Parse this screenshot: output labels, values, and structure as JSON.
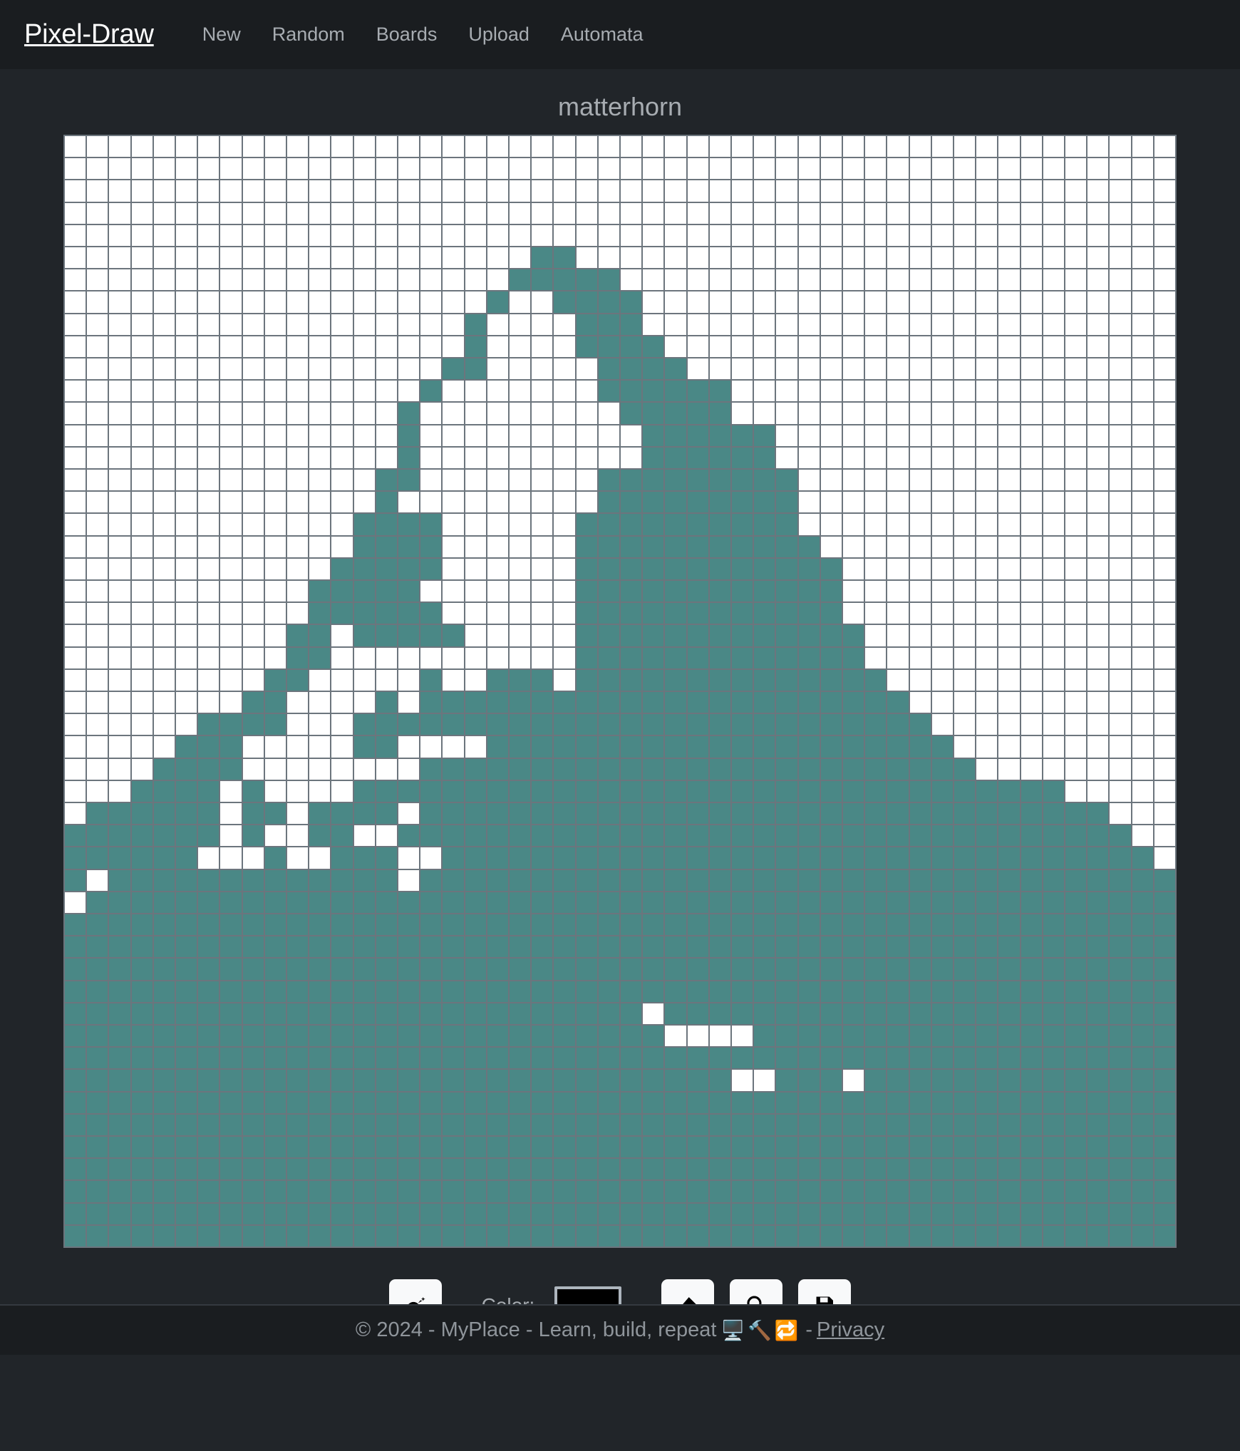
{
  "navbar": {
    "brand": "Pixel-Draw",
    "links": [
      {
        "label": "New",
        "name": "nav-link-new"
      },
      {
        "label": "Random",
        "name": "nav-link-random"
      },
      {
        "label": "Boards",
        "name": "nav-link-boards"
      },
      {
        "label": "Upload",
        "name": "nav-link-upload"
      },
      {
        "label": "Automata",
        "name": "nav-link-automata"
      }
    ]
  },
  "board": {
    "title": "matterhorn",
    "rows": 50,
    "cols": 50,
    "on_color": "#4a8886",
    "off_color": "#ffffff",
    "grid_line_color": "#6c757d"
  },
  "toolbar": {
    "bomb_icon": "bomb-icon",
    "color_label": "Color:",
    "color_value": "#000000",
    "eraser_icon": "eraser-icon",
    "zoom_icon": "magnifier-icon",
    "save_icon": "floppy-disk-icon"
  },
  "footer": {
    "copyright": "© 2024 - MyPlace - Learn, build, repeat",
    "emojis": "🖥️🔨🔁",
    "separator": "-",
    "privacy_label": "Privacy"
  },
  "pixels": {
    "5": [
      [
        21,
        22
      ]
    ],
    "6": [
      [
        20,
        24
      ]
    ],
    "7": [
      [
        19,
        19
      ],
      [
        22,
        25
      ]
    ],
    "8": [
      [
        18,
        18
      ],
      [
        23,
        25
      ]
    ],
    "9": [
      [
        18,
        18
      ],
      [
        23,
        26
      ]
    ],
    "10": [
      [
        17,
        18
      ],
      [
        24,
        27
      ]
    ],
    "11": [
      [
        16,
        16
      ],
      [
        24,
        29
      ]
    ],
    "12": [
      [
        15,
        15
      ],
      [
        25,
        29
      ]
    ],
    "13": [
      [
        15,
        15
      ],
      [
        26,
        31
      ]
    ],
    "14": [
      [
        15,
        15
      ],
      [
        26,
        31
      ]
    ],
    "15": [
      [
        14,
        15
      ],
      [
        24,
        32
      ]
    ],
    "16": [
      [
        14,
        14
      ],
      [
        24,
        32
      ]
    ],
    "17": [
      [
        13,
        16
      ],
      [
        23,
        32
      ]
    ],
    "18": [
      [
        13,
        16
      ],
      [
        23,
        33
      ]
    ],
    "19": [
      [
        12,
        16
      ],
      [
        23,
        34
      ]
    ],
    "20": [
      [
        11,
        15
      ],
      [
        23,
        34
      ]
    ],
    "21": [
      [
        11,
        16
      ],
      [
        23,
        34
      ]
    ],
    "22": [
      [
        10,
        11
      ],
      [
        13,
        17
      ],
      [
        23,
        35
      ]
    ],
    "23": [
      [
        10,
        11
      ],
      [
        23,
        35
      ]
    ],
    "24": [
      [
        9,
        10
      ],
      [
        16,
        16
      ],
      [
        19,
        21
      ],
      [
        23,
        36
      ]
    ],
    "25": [
      [
        8,
        9
      ],
      [
        14,
        14
      ],
      [
        16,
        37
      ]
    ],
    "26": [
      [
        6,
        9
      ],
      [
        13,
        38
      ]
    ],
    "27": [
      [
        5,
        7
      ],
      [
        13,
        14
      ],
      [
        19,
        39
      ]
    ],
    "28": [
      [
        4,
        7
      ],
      [
        16,
        40
      ]
    ],
    "29": [
      [
        3,
        6
      ],
      [
        8,
        8
      ],
      [
        13,
        44
      ]
    ],
    "30": [
      [
        1,
        6
      ],
      [
        8,
        9
      ],
      [
        11,
        14
      ],
      [
        16,
        46
      ]
    ],
    "31": [
      [
        0,
        6
      ],
      [
        8,
        8
      ],
      [
        11,
        12
      ],
      [
        15,
        47
      ]
    ],
    "32": [
      [
        0,
        5
      ],
      [
        9,
        9
      ],
      [
        12,
        14
      ],
      [
        17,
        48
      ]
    ],
    "33": [
      [
        0,
        0
      ],
      [
        2,
        14
      ],
      [
        16,
        49
      ]
    ],
    "34": [
      [
        1,
        49
      ]
    ],
    "35": [
      [
        0,
        49
      ]
    ],
    "36": [
      [
        0,
        49
      ]
    ],
    "37": [
      [
        0,
        49
      ]
    ],
    "38": [
      [
        0,
        49
      ]
    ],
    "39": [
      [
        0,
        25
      ],
      [
        27,
        49
      ]
    ],
    "40": [
      [
        0,
        26
      ],
      [
        31,
        49
      ]
    ],
    "41": [
      [
        0,
        49
      ]
    ],
    "42": [
      [
        0,
        29
      ],
      [
        32,
        34
      ],
      [
        36,
        49
      ]
    ],
    "43": [
      [
        0,
        49
      ]
    ],
    "44": [
      [
        0,
        49
      ]
    ],
    "45": [
      [
        0,
        49
      ]
    ],
    "46": [
      [
        0,
        49
      ]
    ],
    "47": [
      [
        0,
        49
      ]
    ],
    "48": [
      [
        0,
        49
      ]
    ],
    "49": [
      [
        0,
        49
      ]
    ]
  }
}
